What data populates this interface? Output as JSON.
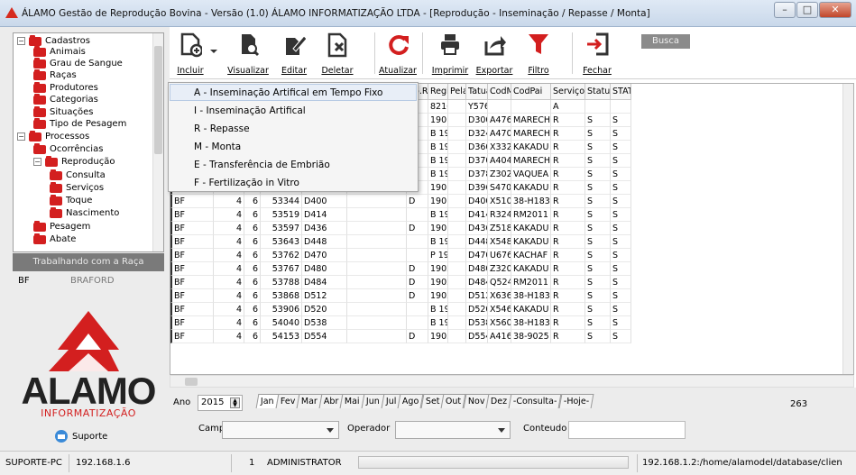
{
  "window": {
    "title": "ÁLAMO Gestão de Reprodução Bovina - Versão (1.0) ÁLAMO INFORMATIZAÇÃO LTDA - [Reprodução - Inseminação / Repasse / Monta]",
    "buttons": [
      "–",
      "□",
      "✕"
    ]
  },
  "tree": [
    {
      "label": "Cadastros",
      "level": 0,
      "exp": "−"
    },
    {
      "label": "Animais",
      "level": 1
    },
    {
      "label": "Grau de Sangue",
      "level": 1
    },
    {
      "label": "Raças",
      "level": 1
    },
    {
      "label": "Produtores",
      "level": 1
    },
    {
      "label": "Categorias",
      "level": 1
    },
    {
      "label": "Situações",
      "level": 1
    },
    {
      "label": "Tipo de Pesagem",
      "level": 1
    },
    {
      "label": "Processos",
      "level": 0,
      "exp": "−"
    },
    {
      "label": "Ocorrências",
      "level": 1
    },
    {
      "label": "Reprodução",
      "level": 1,
      "exp": "−"
    },
    {
      "label": "Consulta",
      "level": 2
    },
    {
      "label": "Serviços",
      "level": 2
    },
    {
      "label": "Toque",
      "level": 2
    },
    {
      "label": "Nascimento",
      "level": 2
    },
    {
      "label": "Pesagem",
      "level": 1
    },
    {
      "label": "Abate",
      "level": 1
    }
  ],
  "raca": {
    "header": "Trabalhando com a Raça",
    "code": "BF",
    "name": "BRAFORD"
  },
  "brand": {
    "name": "ALAMO",
    "sub": "INFORMATIZAÇÃO",
    "support": "Suporte"
  },
  "toolbar": {
    "incluir": "Incluir",
    "visualizar": "Visualizar",
    "editar": "Editar",
    "deletar": "Deletar",
    "atualizar": "Atualizar",
    "imprimir": "Imprimir",
    "exportar": "Exportar",
    "filtro": "Filtro",
    "fechar": "Fechar",
    "busca": "Busca"
  },
  "menu": [
    "A - Inseminação Artifical em Tempo Fixo",
    "I - Inseminação Artifical",
    "R - Repasse",
    "M - Monta",
    "E - Transferência de Embrião",
    "F - Fertilização in Vitro"
  ],
  "grid": {
    "headers": [
      "",
      "",
      "",
      "",
      "",
      "ntre",
      "Tp.Re",
      "Regis",
      "Pelag",
      "Tatua",
      "CodMae",
      "CodPai",
      "Serviço",
      "Status",
      "STAT"
    ],
    "rows": [
      [
        "",
        "",
        "",
        "",
        "",
        "",
        "",
        "82167",
        "",
        "Y576",
        "",
        "",
        "A",
        "",
        ""
      ],
      [
        "",
        "",
        "",
        "",
        "",
        "",
        "D",
        "19011",
        "",
        "D300",
        "A476",
        "MARECH",
        "R",
        "S",
        "S"
      ],
      [
        "",
        "",
        "",
        "",
        "",
        "",
        "",
        "B 190",
        "",
        "D324",
        "A470",
        "MARECH",
        "R",
        "S",
        "S"
      ],
      [
        "",
        "",
        "",
        "",
        "",
        "",
        "",
        "B 190",
        "",
        "D360",
        "X332",
        "KAKADU",
        "R",
        "S",
        "S"
      ],
      [
        "",
        "",
        "",
        "",
        "",
        "",
        "",
        "B 190",
        "",
        "D370",
        "A404",
        "MARECH",
        "R",
        "S",
        "S"
      ],
      [
        "",
        "",
        "",
        "",
        "",
        "",
        "",
        "B 190",
        "",
        "D378",
        "Z302",
        "VAQUEA",
        "R",
        "S",
        "S"
      ],
      [
        "BF",
        "4",
        "6",
        "53305",
        "D396",
        "",
        "D",
        "19016",
        "",
        "D396",
        "S470",
        "KAKADU",
        "R",
        "S",
        "S"
      ],
      [
        "BF",
        "4",
        "6",
        "53344",
        "D400",
        "",
        "D",
        "19016",
        "",
        "D400",
        "X510",
        "38-H183",
        "R",
        "S",
        "S"
      ],
      [
        "BF",
        "4",
        "6",
        "53519",
        "D414",
        "",
        "",
        "B 190",
        "",
        "D414",
        "R324",
        "RM2011",
        "R",
        "S",
        "S"
      ],
      [
        "BF",
        "4",
        "6",
        "53597",
        "D436",
        "",
        "D",
        "19018",
        "",
        "D436",
        "Z518",
        "KAKADU",
        "R",
        "S",
        "S"
      ],
      [
        "BF",
        "4",
        "6",
        "53643",
        "D448",
        "",
        "",
        "B 190",
        "",
        "D448",
        "X548",
        "KAKADU",
        "R",
        "S",
        "S"
      ],
      [
        "BF",
        "4",
        "6",
        "53762",
        "D470",
        "",
        "",
        "P 190",
        "",
        "D470",
        "U676",
        "KACHAF",
        "R",
        "S",
        "S"
      ],
      [
        "BF",
        "4",
        "6",
        "53767",
        "D480",
        "",
        "D",
        "19021",
        "",
        "D480",
        "Z320",
        "KAKADU",
        "R",
        "S",
        "S"
      ],
      [
        "BF",
        "4",
        "6",
        "53788",
        "D484",
        "",
        "D",
        "19021",
        "",
        "D484",
        "Q524",
        "RM2011",
        "R",
        "S",
        "S"
      ],
      [
        "BF",
        "4",
        "6",
        "53868",
        "D512",
        "",
        "D",
        "19023",
        "",
        "D512",
        "X636",
        "38-H183",
        "R",
        "S",
        "S"
      ],
      [
        "BF",
        "4",
        "6",
        "53906",
        "D520",
        "",
        "",
        "B 190",
        "",
        "D520",
        "X546",
        "KAKADU",
        "R",
        "S",
        "S"
      ],
      [
        "BF",
        "4",
        "6",
        "54040",
        "D538",
        "",
        "",
        "B 190",
        "",
        "D538",
        "X560",
        "38-H183",
        "R",
        "S",
        "S"
      ],
      [
        "BF",
        "4",
        "6",
        "54153",
        "D554",
        "",
        "D",
        "19032",
        "",
        "D554",
        "A416",
        "38-9025",
        "R",
        "S",
        "S"
      ]
    ]
  },
  "filters": {
    "ano_label": "Ano",
    "ano": "2015",
    "tabs": [
      "Jan",
      "Fev",
      "Mar",
      "Abr",
      "Mai",
      "Jun",
      "Jul",
      "Ago",
      "Set",
      "Out",
      "Nov",
      "Dez",
      "-Consulta-",
      "-Hoje-"
    ],
    "count": "263",
    "campo": "Campo",
    "operador": "Operador",
    "conteudo": "Conteudo"
  },
  "status": {
    "pc": "SUPORTE-PC",
    "ip": "192.168.1.6",
    "n": "1",
    "user": "ADMINISTRATOR",
    "db": "192.168.1.2:/home/alamodel/database/clien"
  }
}
